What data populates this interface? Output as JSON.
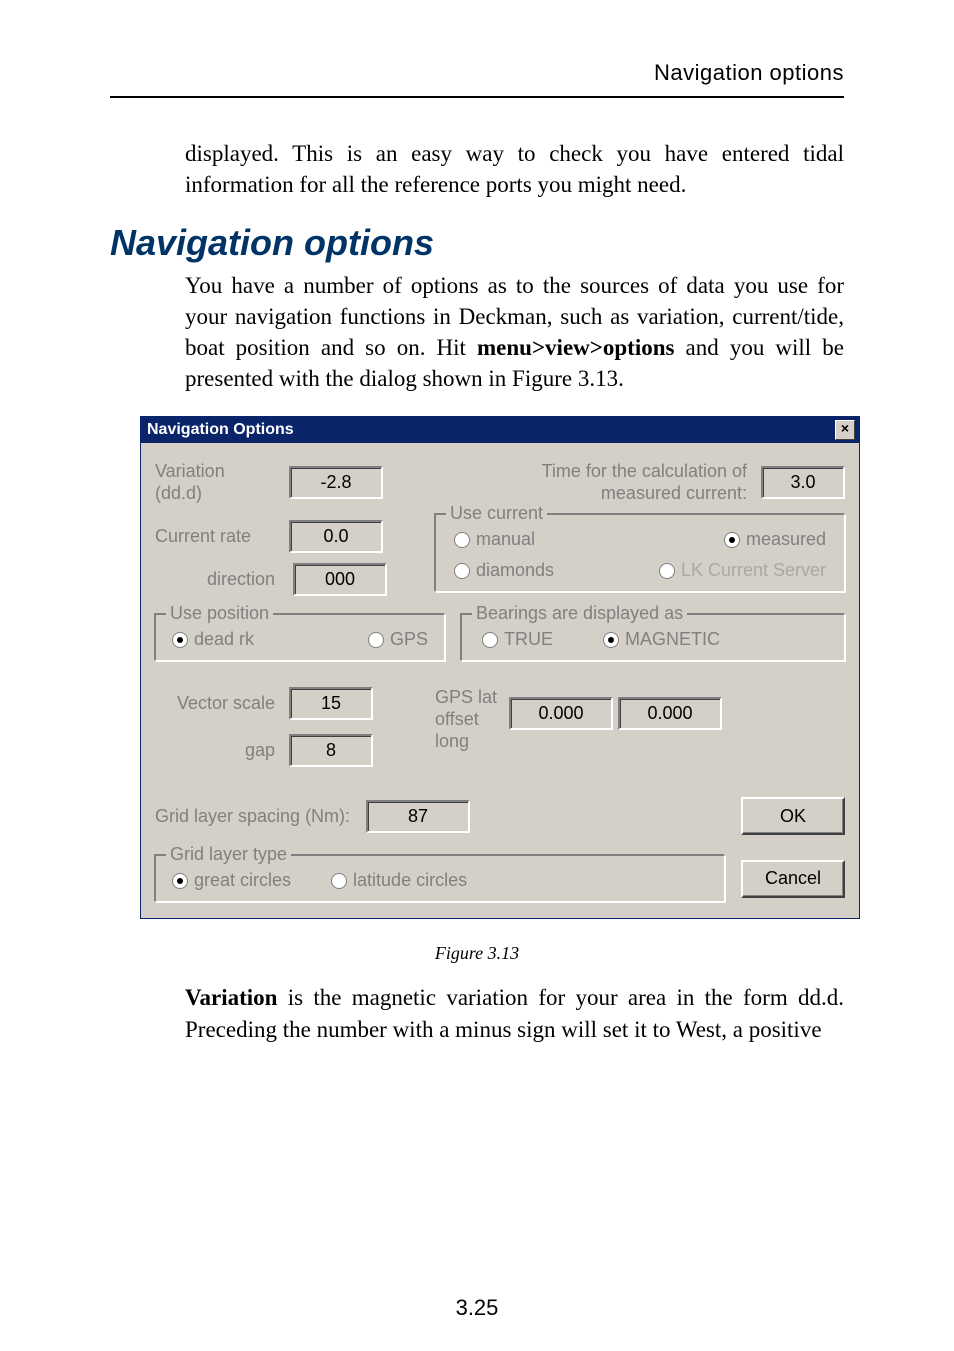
{
  "header": {
    "running": "Navigation options"
  },
  "para1": "displayed. This is an easy way to check you have entered tidal information for all the reference ports you might need.",
  "section_title": "Navigation options",
  "para2a": "You have a number of options as to the sources of data you use for your navigation functions in Deckman, such as variation, current/tide, boat position and so on. Hit ",
  "para2_menu": "menu>view>options",
  "para2b": " and you will be presented with the dialog shown in Figure 3.13.",
  "dlg": {
    "title": "Navigation Options",
    "close_glyph": "×",
    "variation_label": "Variation (dd.d)",
    "variation_value": "-2.8",
    "time_calc_label_a": "Time for the calculation of",
    "time_calc_label_b": "measured current:",
    "time_calc_value": "3.0",
    "current_rate_label": "Current rate",
    "current_rate_value": "0.0",
    "direction_label": "direction",
    "direction_value": "000",
    "use_current_legend": "Use current",
    "uc_manual": "manual",
    "uc_measured": "measured",
    "uc_diamonds": "diamonds",
    "uc_lk": "LK Current Server",
    "use_position_legend": "Use position",
    "up_deadrk": "dead rk",
    "up_gps": "GPS",
    "bearings_legend": "Bearings are displayed as",
    "b_true": "TRUE",
    "b_magnetic": "MAGNETIC",
    "vector_scale_label": "Vector scale",
    "vector_scale_value": "15",
    "gap_label": "gap",
    "gap_value": "8",
    "gps_offset_label_a": "GPS lat",
    "gps_offset_label_b": "offset",
    "gps_offset_label_c": "long",
    "gps_lat_value": "0.000",
    "gps_long_value": "0.000",
    "grid_spacing_label": "Grid layer spacing (Nm):",
    "grid_spacing_value": "87",
    "ok_label": "OK",
    "grid_type_legend": "Grid layer type",
    "gt_great": "great circles",
    "gt_lat": "latitude circles",
    "cancel_label": "Cancel"
  },
  "fig_caption": "Figure 3.13",
  "para3a": "Variation",
  "para3b": " is the magnetic variation for your area in the form dd.d. Preceding the number with a minus sign will set it to West, a positive",
  "page_number": "3.25"
}
